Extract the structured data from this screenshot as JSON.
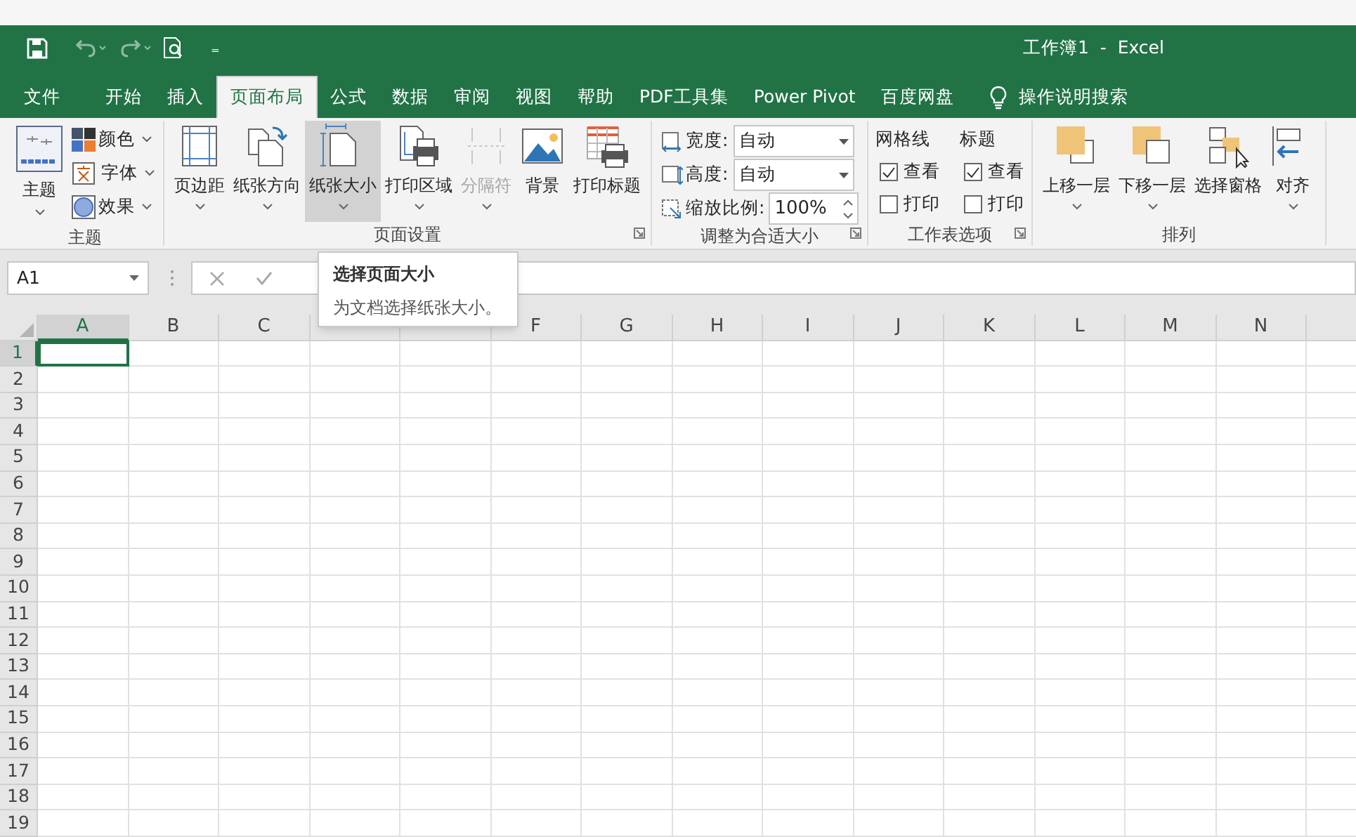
{
  "window": {
    "title": "工作簿1  -  Excel"
  },
  "quick_access": {
    "customize": "₌"
  },
  "tabs": [
    {
      "label": "文件",
      "selected": false
    },
    {
      "label": "开始",
      "selected": false
    },
    {
      "label": "插入",
      "selected": false
    },
    {
      "label": "页面布局",
      "selected": true
    },
    {
      "label": "公式",
      "selected": false
    },
    {
      "label": "数据",
      "selected": false
    },
    {
      "label": "审阅",
      "selected": false
    },
    {
      "label": "视图",
      "selected": false
    },
    {
      "label": "帮助",
      "selected": false
    },
    {
      "label": "PDF工具集",
      "selected": false
    },
    {
      "label": "Power Pivot",
      "selected": false
    },
    {
      "label": "百度网盘",
      "selected": false
    }
  ],
  "tell_me": "操作说明搜索",
  "ribbon": {
    "groups": [
      {
        "kind": "themes",
        "label": "主题",
        "launcher": false,
        "big": {
          "label": "主题",
          "dropdown": true
        },
        "small": [
          {
            "label": "颜色"
          },
          {
            "label": "字体"
          },
          {
            "label": "效果"
          }
        ]
      },
      {
        "kind": "buttons",
        "label": "页面设置",
        "launcher": true,
        "buttons": [
          {
            "label": "页边距",
            "dropdown": true,
            "disabled": false,
            "selected": false
          },
          {
            "label": "纸张方向",
            "dropdown": true,
            "disabled": false,
            "selected": false
          },
          {
            "label": "纸张大小",
            "dropdown": true,
            "disabled": false,
            "selected": true
          },
          {
            "label": "打印区域",
            "dropdown": true,
            "disabled": false,
            "selected": false
          },
          {
            "label": "分隔符",
            "dropdown": true,
            "disabled": true,
            "selected": false
          },
          {
            "label": "背景",
            "dropdown": false,
            "disabled": false,
            "selected": false
          },
          {
            "label": "打印标题",
            "dropdown": false,
            "disabled": false,
            "selected": false
          }
        ]
      },
      {
        "kind": "fit",
        "label": "调整为合适大小",
        "launcher": true,
        "rows": [
          {
            "kind": "dropdown",
            "label": "宽度:",
            "value": "自动"
          },
          {
            "kind": "dropdown",
            "label": "高度:",
            "value": "自动"
          },
          {
            "kind": "spinner",
            "label": "缩放比例:",
            "value": "100%"
          }
        ]
      },
      {
        "kind": "sheet_options",
        "label": "工作表选项",
        "launcher": true,
        "columns": [
          {
            "title": "网格线",
            "options": [
              {
                "label": "查看",
                "checked": true
              },
              {
                "label": "打印",
                "checked": false
              }
            ]
          },
          {
            "title": "标题",
            "options": [
              {
                "label": "查看",
                "checked": true
              },
              {
                "label": "打印",
                "checked": false
              }
            ]
          }
        ]
      },
      {
        "kind": "buttons",
        "label": "排列",
        "launcher": false,
        "buttons": [
          {
            "label": "上移一层",
            "dropdown": true,
            "disabled": false,
            "selected": false
          },
          {
            "label": "下移一层",
            "dropdown": true,
            "disabled": false,
            "selected": false
          },
          {
            "label": "选择窗格",
            "dropdown": false,
            "disabled": false,
            "selected": false
          },
          {
            "label": "对齐",
            "dropdown": true,
            "disabled": false,
            "selected": false
          }
        ]
      }
    ]
  },
  "name_box": {
    "value": "A1"
  },
  "tooltip": {
    "title": "选择页面大小",
    "text": "为文档选择纸张大小。"
  },
  "sheet": {
    "columns": [
      {
        "label": "A",
        "selected": true
      },
      {
        "label": "B",
        "selected": false
      },
      {
        "label": "C",
        "selected": false
      },
      {
        "selected": false
      },
      {
        "selected": false
      },
      {
        "label": "F",
        "selected": false
      },
      {
        "label": "G",
        "selected": false
      },
      {
        "label": "H",
        "selected": false
      },
      {
        "label": "I",
        "selected": false
      },
      {
        "label": "J",
        "selected": false
      },
      {
        "label": "K",
        "selected": false
      },
      {
        "label": "L",
        "selected": false
      },
      {
        "label": "M",
        "selected": false
      },
      {
        "label": "N",
        "selected": false
      },
      {
        "selected": false
      }
    ],
    "rows": [
      {
        "label": "1",
        "selected": true
      },
      {
        "label": "2",
        "selected": false
      },
      {
        "label": "3",
        "selected": false
      },
      {
        "label": "4",
        "selected": false
      },
      {
        "label": "5",
        "selected": false
      },
      {
        "label": "6",
        "selected": false
      },
      {
        "label": "7",
        "selected": false
      },
      {
        "label": "8",
        "selected": false
      },
      {
        "label": "9",
        "selected": false
      },
      {
        "label": "10",
        "selected": false
      },
      {
        "label": "11",
        "selected": false
      },
      {
        "label": "12",
        "selected": false
      },
      {
        "label": "13",
        "selected": false
      },
      {
        "label": "14",
        "selected": false
      },
      {
        "label": "15",
        "selected": false
      },
      {
        "label": "16",
        "selected": false
      },
      {
        "label": "17",
        "selected": false
      },
      {
        "label": "18",
        "selected": false
      },
      {
        "label": "19",
        "selected": false
      }
    ]
  }
}
